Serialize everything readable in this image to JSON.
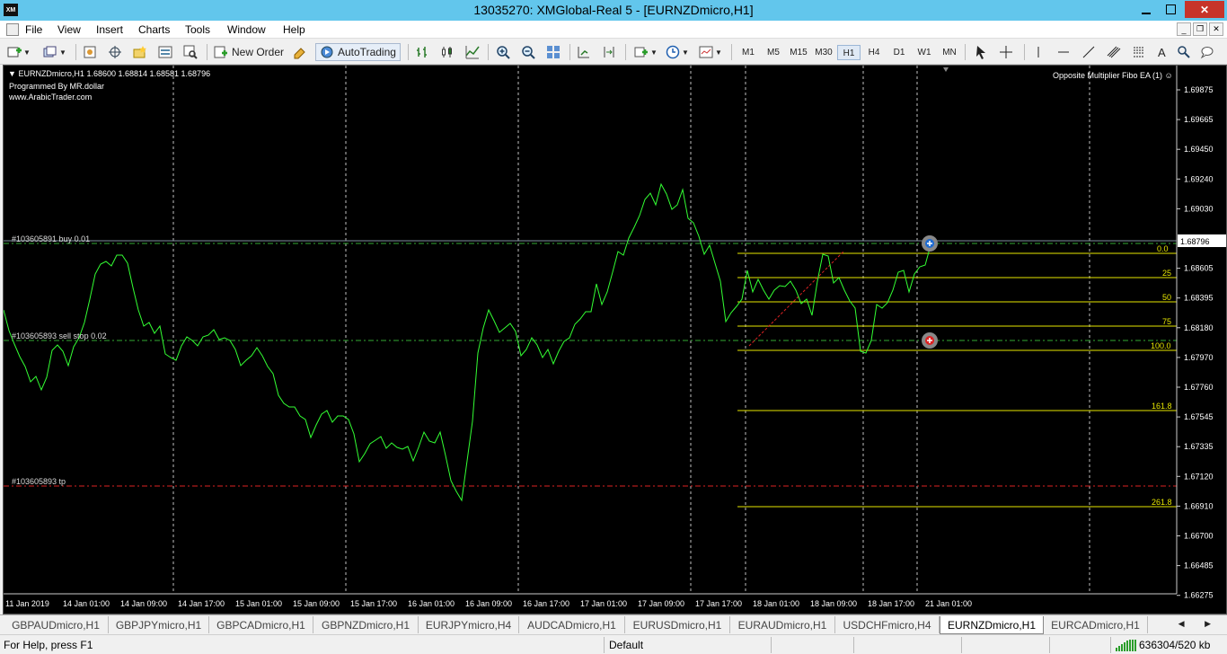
{
  "window": {
    "title": "13035270: XMGlobal-Real 5 - [EURNZDmicro,H1]",
    "app_icon": "XM",
    "controls": {
      "minimize": "minimize-icon",
      "maximize": "maximize-icon",
      "close": "✕"
    }
  },
  "menu": {
    "items": [
      "File",
      "View",
      "Insert",
      "Charts",
      "Tools",
      "Window",
      "Help"
    ],
    "mdi": {
      "minimize": "_",
      "restore": "❐",
      "close": "✕"
    }
  },
  "toolbar": {
    "new_order": "New Order",
    "autotrading": "AutoTrading",
    "timeframes": [
      "M1",
      "M5",
      "M15",
      "M30",
      "H1",
      "H4",
      "D1",
      "W1",
      "MN"
    ],
    "active_timeframe": "H1"
  },
  "chart": {
    "header": "EURNZDmicro,H1  1.68600 1.68814 1.68581 1.68796",
    "comment_lines": [
      "Programmed By MR.dollar",
      "www.ArabicTrader.com"
    ],
    "ea_label": "Opposite Multiplier Fibo EA (1) ☺",
    "current_price": "1.68796",
    "order_labels": {
      "buy": "#103605891 buy 0.01",
      "sell_stop": "#103605893 sell stop 0.02",
      "tp": "#103605893 tp"
    },
    "fib_labels": [
      "0.0",
      "25",
      "50",
      "75",
      "100.0",
      "161.8",
      "261.8"
    ],
    "price_axis": [
      "1.69875",
      "1.69665",
      "1.69450",
      "1.69240",
      "1.69030",
      "1.68605",
      "1.68395",
      "1.68180",
      "1.67970",
      "1.67760",
      "1.67545",
      "1.67335",
      "1.67120",
      "1.66910",
      "1.66700",
      "1.66485",
      "1.66275"
    ],
    "time_axis": [
      "11 Jan 2019",
      "14 Jan 01:00",
      "14 Jan 09:00",
      "14 Jan 17:00",
      "15 Jan 01:00",
      "15 Jan 09:00",
      "15 Jan 17:00",
      "16 Jan 01:00",
      "16 Jan 09:00",
      "16 Jan 17:00",
      "17 Jan 01:00",
      "17 Jan 09:00",
      "17 Jan 17:00",
      "18 Jan 01:00",
      "18 Jan 09:00",
      "18 Jan 17:00",
      "21 Jan 01:00"
    ],
    "colors": {
      "price_line": "#33ff33",
      "fib": "#e6e600",
      "tp": "#dd2222",
      "orders": "#33aa33",
      "grid": "#bfbfbf"
    }
  },
  "tabs": {
    "items": [
      "GBPAUDmicro,H1",
      "GBPJPYmicro,H1",
      "GBPCADmicro,H1",
      "GBPNZDmicro,H1",
      "EURJPYmicro,H4",
      "AUDCADmicro,H1",
      "EURUSDmicro,H1",
      "EURAUDmicro,H1",
      "USDCHFmicro,H4",
      "EURNZDmicro,H1",
      "EURCADmicro,H1"
    ],
    "active": "EURNZDmicro,H1",
    "arrows": "◀ ▶"
  },
  "status": {
    "help": "For Help, press F1",
    "profile": "Default",
    "traffic": "636304/520 kb"
  }
}
